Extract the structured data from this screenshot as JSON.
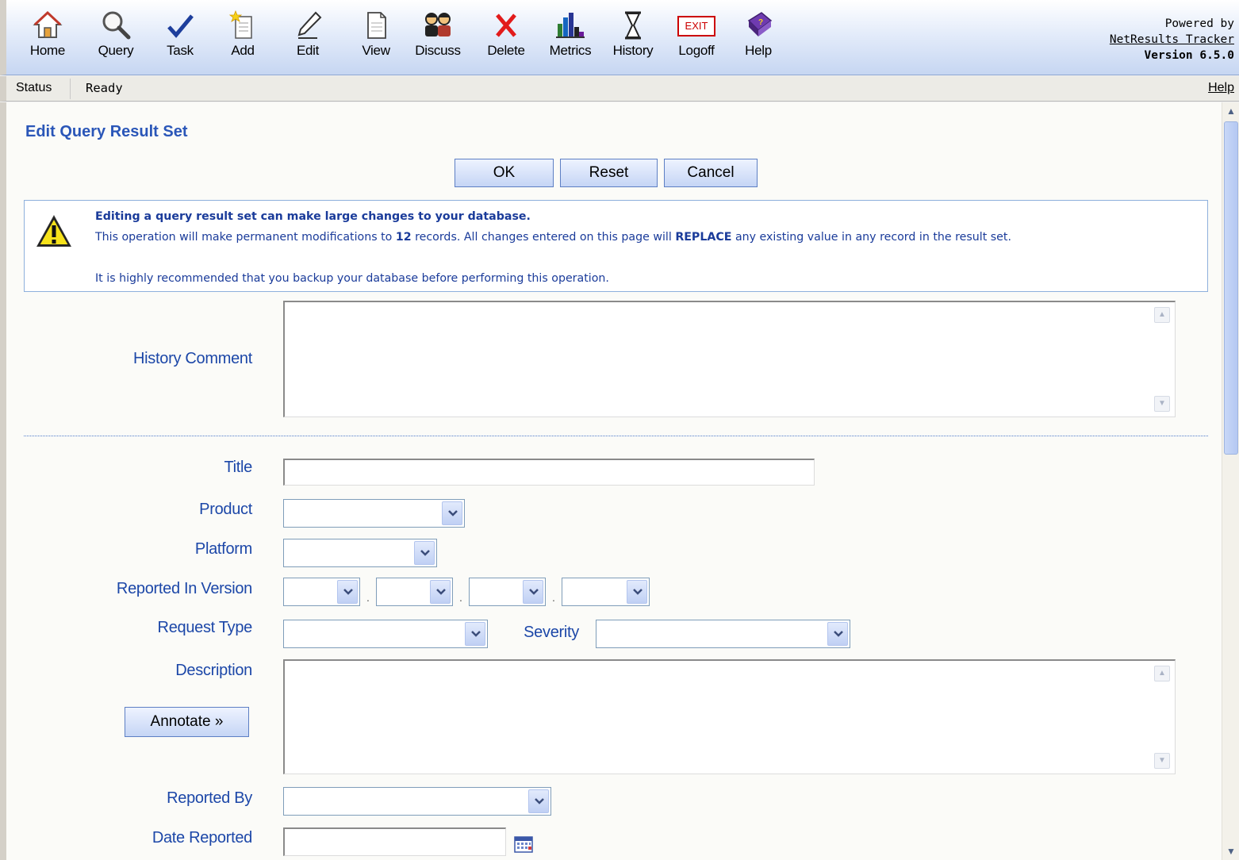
{
  "toolbar": {
    "buttons": [
      {
        "label": "Home",
        "icon": "home-icon"
      },
      {
        "label": "Query",
        "icon": "magnifier-icon"
      },
      {
        "label": "Task",
        "icon": "checkmark-icon"
      },
      {
        "label": "Add",
        "icon": "add-document-icon"
      },
      {
        "label": "Edit",
        "icon": "pencil-icon"
      },
      {
        "label": "View",
        "icon": "document-icon"
      },
      {
        "label": "Discuss",
        "icon": "people-icon"
      },
      {
        "label": "Delete",
        "icon": "red-x-icon"
      },
      {
        "label": "Metrics",
        "icon": "bar-chart-icon"
      },
      {
        "label": "History",
        "icon": "hourglass-icon"
      },
      {
        "label": "Logoff",
        "icon": "exit-sign-icon"
      },
      {
        "label": "Help",
        "icon": "help-book-icon"
      }
    ],
    "exit_sign_text": "EXIT",
    "powered_by": "Powered by",
    "product_link": "NetResults Tracker",
    "version": "Version 6.5.0"
  },
  "status_bar": {
    "label": "Status",
    "text": "Ready",
    "help": "Help"
  },
  "page": {
    "title": "Edit Query Result Set",
    "buttons": {
      "ok": "OK",
      "reset": "Reset",
      "cancel": "Cancel"
    }
  },
  "warning": {
    "heading": "Editing a query result set can make large changes to your database.",
    "body_prefix": "This operation will make permanent modifications to ",
    "record_count": "12",
    "body_middle": " records. All changes entered on this page will ",
    "replace_word": "REPLACE",
    "body_suffix": " any existing value in any record in the result set.",
    "recommendation": "It is highly recommended that you backup your database before performing this operation."
  },
  "form": {
    "history_comment": {
      "label": "History Comment",
      "value": ""
    },
    "title": {
      "label": "Title",
      "value": ""
    },
    "product": {
      "label": "Product",
      "value": ""
    },
    "platform": {
      "label": "Platform",
      "value": ""
    },
    "reported_in_version": {
      "label": "Reported In Version",
      "separator": "."
    },
    "request_type": {
      "label": "Request Type",
      "value": ""
    },
    "severity": {
      "label": "Severity",
      "value": ""
    },
    "description": {
      "label": "Description",
      "value": ""
    },
    "annotate_button": "Annotate »",
    "reported_by": {
      "label": "Reported By",
      "value": ""
    },
    "date_reported": {
      "label": "Date Reported",
      "value": ""
    }
  },
  "colors": {
    "accent_blue": "#1c47a8",
    "title_blue": "#2a56b8",
    "toolbar_gradient_end": "#c6d6f2"
  }
}
